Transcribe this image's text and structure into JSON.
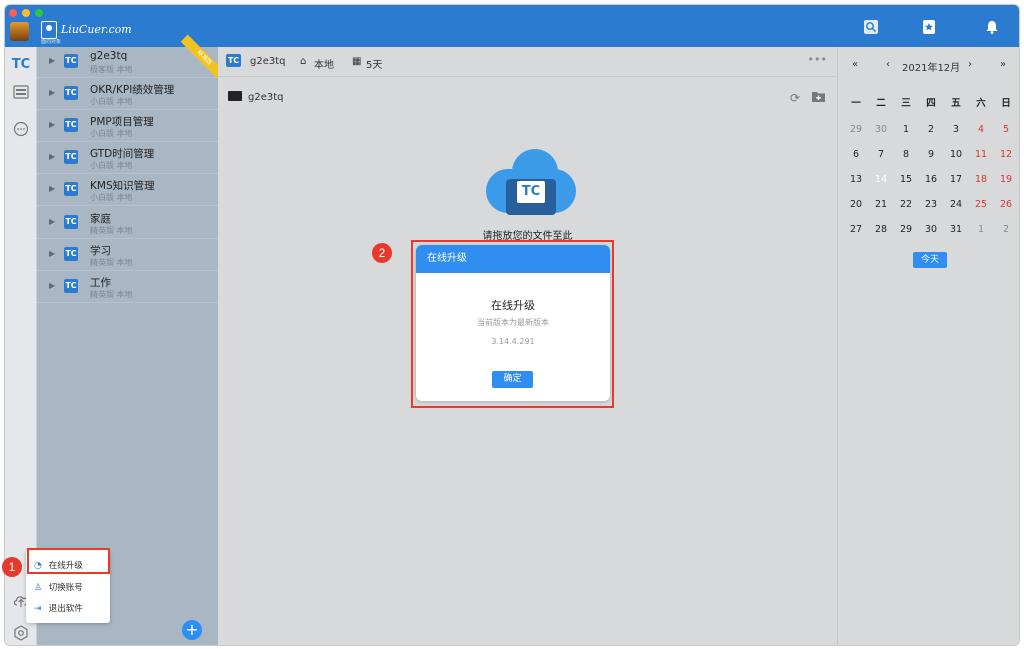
{
  "app": {
    "logo_text": "LiuCuer.com",
    "logo_sub": "面向对象"
  },
  "sidebar": {
    "ribbon": "标准版",
    "projects": [
      {
        "name": "g2e3tq",
        "meta": "极客版  本地"
      },
      {
        "name": "OKR/KPI绩效管理",
        "meta": "小白版  本地"
      },
      {
        "name": "PMP项目管理",
        "meta": "小白版  本地"
      },
      {
        "name": "GTD时间管理",
        "meta": "小白版  本地"
      },
      {
        "name": "KMS知识管理",
        "meta": "小白版  本地"
      },
      {
        "name": "家庭",
        "meta": "精英版  本地"
      },
      {
        "name": "学习",
        "meta": "精英版  本地"
      },
      {
        "name": "工作",
        "meta": "精英版  本地"
      }
    ],
    "add_label": "+"
  },
  "popup_menu": {
    "items": [
      {
        "label": "在线升级"
      },
      {
        "label": "切换账号"
      },
      {
        "label": "退出软件"
      }
    ]
  },
  "annotations": {
    "badge1": "1",
    "badge2": "2"
  },
  "main": {
    "header": {
      "project": "g2e3tq",
      "storage": "本地",
      "days": "5天",
      "more": "•••"
    },
    "folder": "g2e3tq",
    "drop_text": "请拖放您的文件至此",
    "cloud_mark": "TC"
  },
  "modal": {
    "header": "在线升级",
    "title": "在线升级",
    "subtitle": "当前版本为最新版本",
    "version": "3.14.4.291",
    "confirm": "确定"
  },
  "calendar": {
    "first": "«",
    "prev": "‹",
    "month_label": "2021年12月",
    "next": "›",
    "last": "»",
    "weekdays": [
      "一",
      "二",
      "三",
      "四",
      "五",
      "六",
      "日"
    ],
    "today_button": "今天",
    "weeks": [
      [
        "29",
        "30",
        "1",
        "2",
        "3",
        "4",
        "5"
      ],
      [
        "6",
        "7",
        "8",
        "9",
        "10",
        "11",
        "12"
      ],
      [
        "13",
        "14",
        "15",
        "16",
        "17",
        "18",
        "19"
      ],
      [
        "20",
        "21",
        "22",
        "23",
        "24",
        "25",
        "26"
      ],
      [
        "27",
        "28",
        "29",
        "30",
        "31",
        "1",
        "2"
      ]
    ],
    "today": "14"
  },
  "colors": {
    "accent": "#2b7bd0",
    "highlight": "#e8392d",
    "weekend": "#d7372c"
  }
}
